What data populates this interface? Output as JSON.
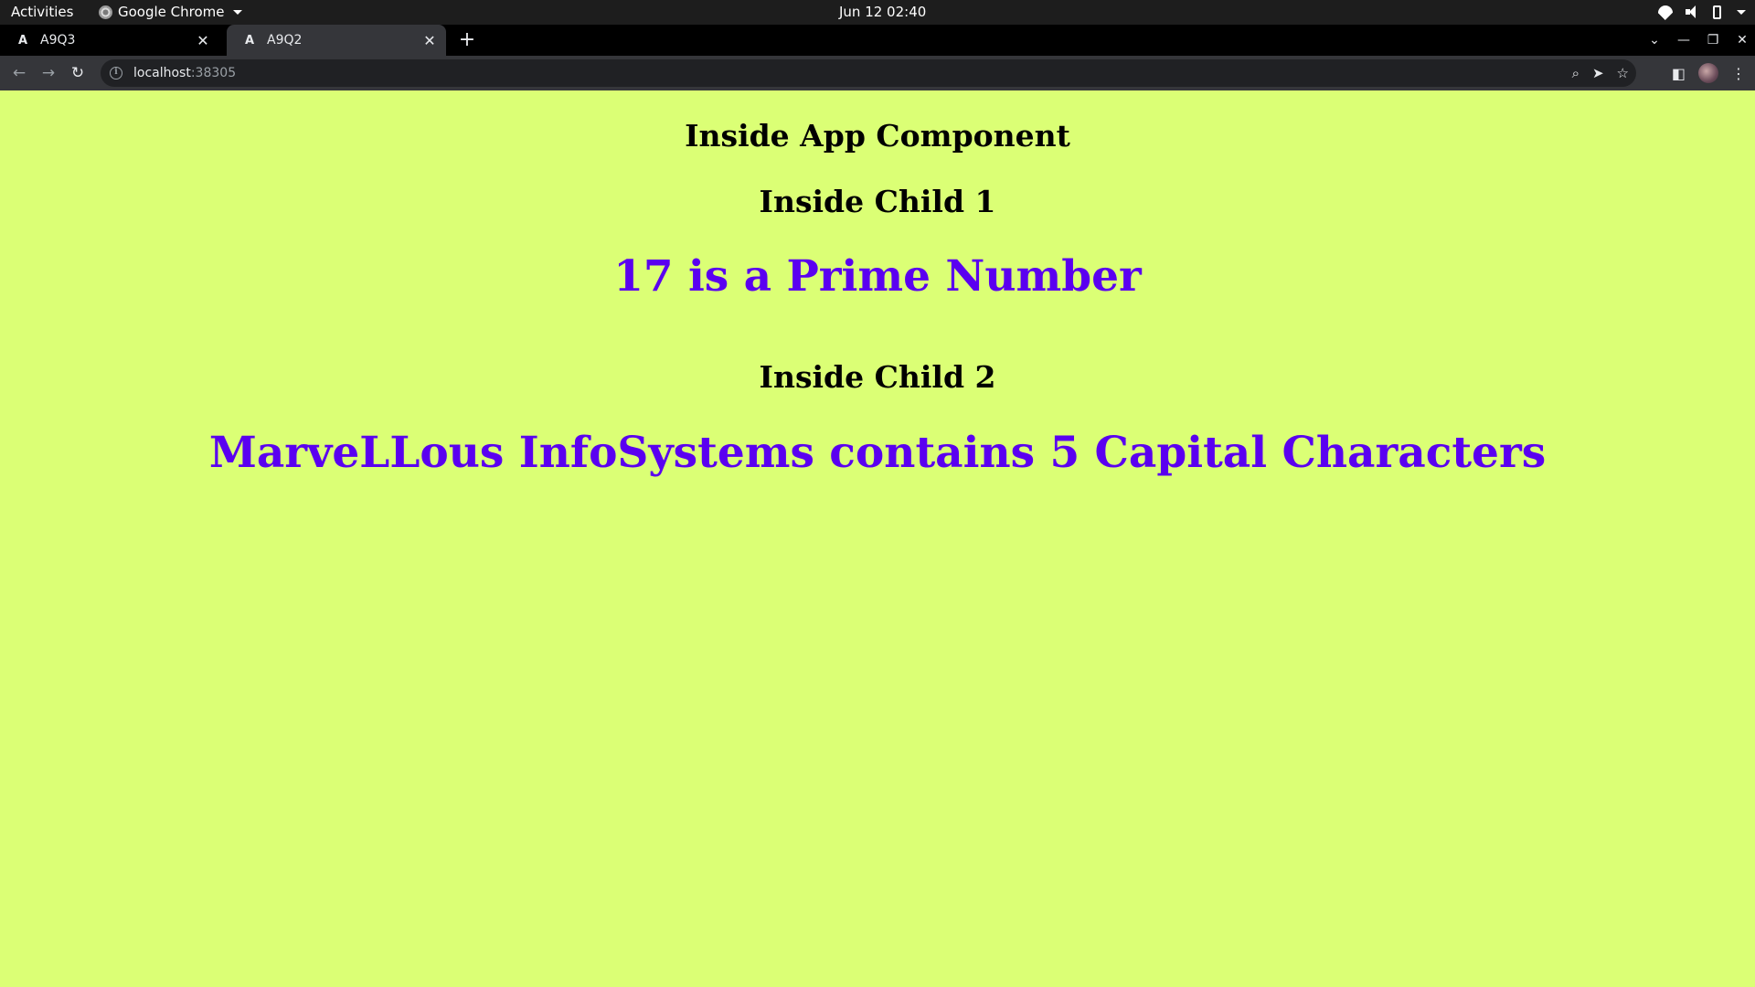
{
  "system_bar": {
    "activities": "Activities",
    "app_name": "Google Chrome",
    "clock": "Jun 12  02:40",
    "icons": [
      "wifi-icon",
      "volume-icon",
      "battery-icon",
      "system-menu-caret-icon"
    ]
  },
  "browser": {
    "tabs": [
      {
        "title": "A9Q3",
        "favicon": "A",
        "active": false
      },
      {
        "title": "A9Q2",
        "favicon": "A",
        "active": true
      }
    ],
    "new_tab": "+",
    "address": {
      "host": "localhost",
      "port": ":38305"
    },
    "toolbar_icons": [
      "zoom-icon",
      "send-icon",
      "bookmark-star-icon",
      "side-panel-icon",
      "profile-avatar",
      "menu-icon"
    ]
  },
  "page": {
    "background": "#dbff75",
    "accent_color": "#5a00f0",
    "app_heading": "Inside App Component",
    "child1_heading": "Inside Child 1",
    "child1_result": "17 is a Prime Number",
    "child2_heading": "Inside Child 2",
    "child2_result": "MarveLLous InfoSystems contains 5 Capital Characters"
  }
}
